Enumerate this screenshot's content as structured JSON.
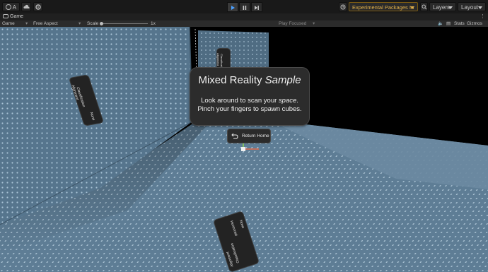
{
  "toolbar": {
    "account_label": "A",
    "experimental_label": "Experimental Packages In Use",
    "layers_label": "Layers",
    "layout_label": "Layout"
  },
  "tab": {
    "game_label": "Game"
  },
  "gamebar": {
    "display_label": "Game",
    "aspect_label": "Free Aspect",
    "scale_label": "Scale",
    "scale_value": "1x",
    "play_focused_label": "Play Focused",
    "stats_label": "Stats",
    "gizmos_label": "Gizmos"
  },
  "panel": {
    "title_text": "Mixed Reality ",
    "title_emph": "Sample",
    "line1_a": "Look around to scan your ",
    "line1_emph": "space",
    "line1_b": ".",
    "line2": "Pinch your fingers to spawn cubes."
  },
  "return_button": {
    "label": "Return Home"
  },
  "cards": {
    "wall_left": {
      "line1": "Alignment",
      "line2": "Classification",
      "line3": "None"
    },
    "back": {
      "line1": "Alignment",
      "line2": "Classification"
    },
    "floor": {
      "line1": "Alignment",
      "line2": "Classification",
      "line3": "Horizontal",
      "line4": "None"
    }
  },
  "colors": {
    "surface": "#5c7a92",
    "dots": "#a9c2d4",
    "accent_warning": "#e2b14a"
  }
}
